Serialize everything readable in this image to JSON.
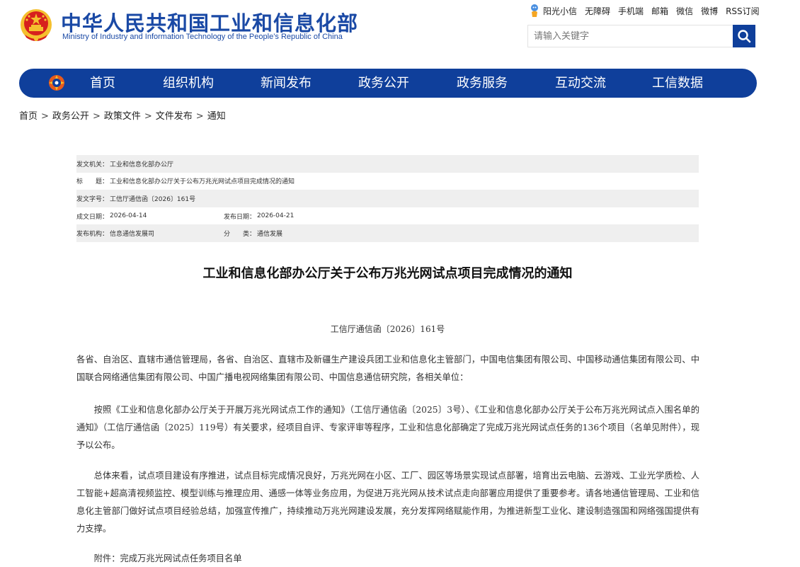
{
  "header": {
    "title_cn": "中华人民共和国工业和信息化部",
    "title_en": "Ministry of Industry and Information Technology of the People’s Republic of China",
    "top_links": [
      "阳光小信",
      "无障碍",
      "手机端",
      "邮箱",
      "微信",
      "微博",
      "RSS订阅"
    ],
    "search": {
      "placeholder": "请输入关键字"
    }
  },
  "nav": {
    "items": [
      "首页",
      "组织机构",
      "新闻发布",
      "政务公开",
      "政务服务",
      "互动交流",
      "工信数据"
    ]
  },
  "breadcrumb": [
    "首页",
    "政务公开",
    "政策文件",
    "文件发布",
    "通知"
  ],
  "breadcrumb_separator": ">",
  "meta": {
    "issuer_label": "发文机关：",
    "issuer": "工业和信息化部办公厅",
    "title_label": "标　　题：",
    "title": "工业和信息化部办公厅关于公布万兆光网试点项目完成情况的通知",
    "doc_no_label": "发文字号：",
    "doc_no": "工信厅通信函〔2026〕161号",
    "written_label": "成文日期：",
    "written_date": "2026-04-14",
    "published_label": "发布日期：",
    "published_date": "2026-04-21",
    "publisher_label": "发布机构：",
    "publisher": "信息通信发展司",
    "category_label": "分　　类：",
    "category": "通信发展"
  },
  "article": {
    "title": "工业和信息化部办公厅关于公布万兆光网试点项目完成情况的通知",
    "doc_number": "工信厅通信函〔2026〕161号",
    "paragraphs": [
      "各省、自治区、直辖市通信管理局，各省、自治区、直辖市及新疆生产建设兵团工业和信息化主管部门，中国电信集团有限公司、中国移动通信集团有限公司、中国联合网络通信集团有限公司、中国广播电视网络集团有限公司、中国信息通信研究院，各相关单位：",
      "按照《工业和信息化部办公厅关于开展万兆光网试点工作的通知》（工信厅通信函〔2025〕3号）、《工业和信息化部办公厅关于公布万兆光网试点入围名单的通知》（工信厅通信函〔2025〕119号）有关要求，经项目自评、专家评审等程序，工业和信息化部确定了完成万兆光网试点任务的136个项目（名单见附件），现予以公布。",
      "总体来看，试点项目建设有序推进，试点目标完成情况良好，万兆光网在小区、工厂、园区等场景实现试点部署，培育出云电脑、云游戏、工业光学质检、人工智能+超高清视频监控、模型训练与推理应用、通感一体等业务应用，为促进万兆光网从技术试点走向部署应用提供了重要参考。请各地通信管理局、工业和信息化主管部门做好试点项目经验总结，加强宣传推广，持续推动万兆光网建设发展，充分发挥网络赋能作用，为推进新型工业化、建设制造强国和网络强国提供有力支撑。",
      "附件：完成万兆光网试点任务项目名单"
    ]
  },
  "colors": {
    "brand_blue": "#1a49a5",
    "nav_blue": "#0f3f9b",
    "meta_shade": "#efefef",
    "emblem_red": "#d7201d",
    "emblem_gold": "#f5c02e"
  }
}
